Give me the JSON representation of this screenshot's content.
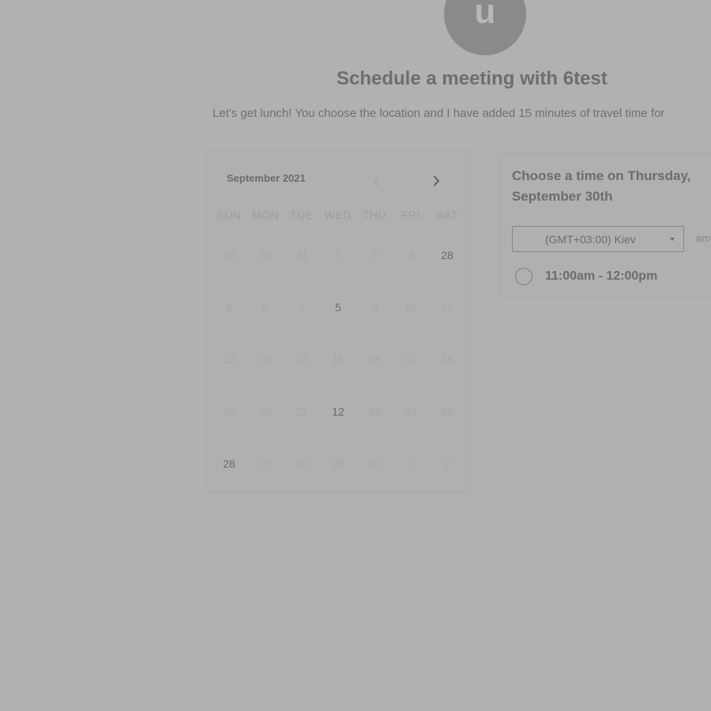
{
  "host": {
    "avatar_letter": "u",
    "title": "Schedule a meeting with 6test",
    "description": "Let's get lunch! You choose the location and I have added 15 minutes of travel time for"
  },
  "calendar": {
    "month_label": "September 2021",
    "weekdays": [
      "SUN",
      "MON",
      "TUE",
      "WED",
      "THU",
      "FRI",
      "SAT"
    ],
    "weeks": [
      [
        {
          "d": "29",
          "a": false
        },
        {
          "d": "30",
          "a": false
        },
        {
          "d": "31",
          "a": false
        },
        {
          "d": "1",
          "a": false
        },
        {
          "d": "2",
          "a": false
        },
        {
          "d": "3",
          "a": false
        },
        {
          "d": "28",
          "a": true
        }
      ],
      [
        {
          "d": "5",
          "a": false
        },
        {
          "d": "6",
          "a": false
        },
        {
          "d": "7",
          "a": false
        },
        {
          "d": "5",
          "a": true
        },
        {
          "d": "9",
          "a": false
        },
        {
          "d": "10",
          "a": false
        },
        {
          "d": "11",
          "a": false
        }
      ],
      [
        {
          "d": "12",
          "a": false
        },
        {
          "d": "13",
          "a": false
        },
        {
          "d": "14",
          "a": false
        },
        {
          "d": "15",
          "a": false
        },
        {
          "d": "16",
          "a": false
        },
        {
          "d": "17",
          "a": false
        },
        {
          "d": "18",
          "a": false
        }
      ],
      [
        {
          "d": "19",
          "a": false
        },
        {
          "d": "20",
          "a": false
        },
        {
          "d": "21",
          "a": false
        },
        {
          "d": "12",
          "a": true
        },
        {
          "d": "23",
          "a": false
        },
        {
          "d": "24",
          "a": false
        },
        {
          "d": "25",
          "a": false
        }
      ],
      [
        {
          "d": "28",
          "a": true
        },
        {
          "d": "27",
          "a": false
        },
        {
          "d": "28",
          "a": false
        },
        {
          "d": "29",
          "a": false
        },
        {
          "d": "30",
          "a": false
        },
        {
          "d": "1",
          "a": false
        },
        {
          "d": "2",
          "a": false
        }
      ]
    ]
  },
  "times": {
    "heading": "Choose a time on Thursday, September 30th",
    "timezone": "(GMT+03:00) Kiev",
    "format_label": "am",
    "slots": [
      "11:00am - 12:00pm"
    ]
  },
  "colors": {
    "overlay": "#b1b1b1",
    "avatar": "#8a8a8a"
  }
}
